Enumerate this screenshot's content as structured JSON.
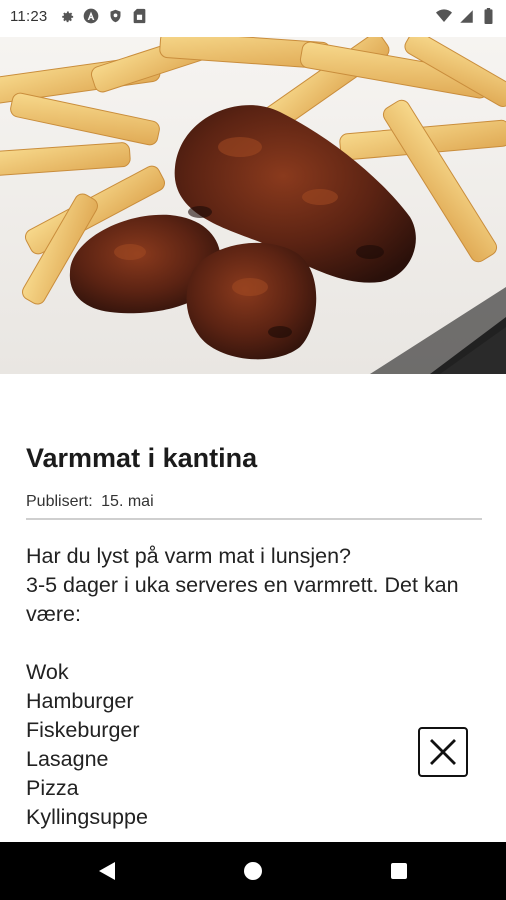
{
  "status_bar": {
    "time": "11:23",
    "left_icons": [
      "settings-icon",
      "a-circle-icon",
      "shield-icon",
      "sim-card-icon"
    ],
    "right_icons": [
      "wifi-icon",
      "signal-icon",
      "battery-icon"
    ]
  },
  "hero": {
    "image": "chicken-wings-with-fries-photo"
  },
  "article": {
    "title": "Varmmat i kantina",
    "published_label": "Publisert:",
    "published_date": "15. mai",
    "intro_line1": "Har du lyst på varm mat i lunsjen?",
    "intro_line2": "3-5 dager i uka serveres en varmrett. Det kan være:",
    "dishes": [
      "Wok",
      "Hamburger",
      "Fiskeburger",
      "Lasagne",
      "Pizza",
      "Kyllingsuppe"
    ]
  },
  "close_button": {
    "icon": "close-icon"
  },
  "nav_bar": {
    "buttons": [
      "back-icon",
      "home-icon",
      "recents-icon"
    ]
  },
  "colors": {
    "nav_bar_bg": "#000000",
    "text": "#1a1a1a",
    "divider": "#cfcfcf"
  }
}
